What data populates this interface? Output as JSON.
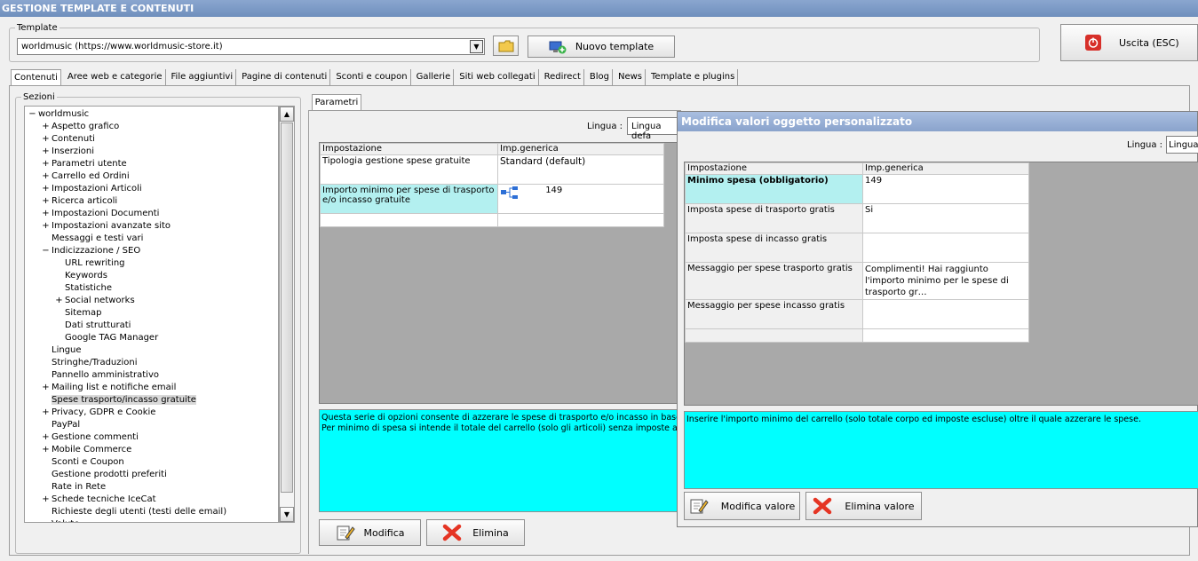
{
  "app": {
    "title": "GESTIONE TEMPLATE E CONTENUTI"
  },
  "template": {
    "group_label": "Template",
    "selected": "worldmusic (https://www.worldmusic-store.it)",
    "new_button": "Nuovo template",
    "exit_button": "Uscita (ESC)"
  },
  "tabs": [
    "Contenuti",
    "Aree web e categorie",
    "File aggiuntivi",
    "Pagine di contenuti",
    "Sconti e coupon",
    "Gallerie",
    "Siti web collegati",
    "Redirect",
    "Blog",
    "News",
    "Template e plugins"
  ],
  "sections": {
    "label": "Sezioni",
    "items": [
      {
        "label": "worldmusic",
        "level": 0,
        "exp": "−"
      },
      {
        "label": "Aspetto grafico",
        "level": 1,
        "exp": "+"
      },
      {
        "label": "Contenuti",
        "level": 1,
        "exp": "+"
      },
      {
        "label": "Inserzioni",
        "level": 1,
        "exp": "+"
      },
      {
        "label": "Parametri utente",
        "level": 1,
        "exp": "+"
      },
      {
        "label": "Carrello ed Ordini",
        "level": 1,
        "exp": "+"
      },
      {
        "label": "Impostazioni Articoli",
        "level": 1,
        "exp": "+"
      },
      {
        "label": "Ricerca articoli",
        "level": 1,
        "exp": "+"
      },
      {
        "label": "Impostazioni Documenti",
        "level": 1,
        "exp": "+"
      },
      {
        "label": "Impostazioni avanzate sito",
        "level": 1,
        "exp": "+"
      },
      {
        "label": "Messaggi e testi vari",
        "level": 1,
        "exp": ""
      },
      {
        "label": "Indicizzazione / SEO",
        "level": 1,
        "exp": "−"
      },
      {
        "label": "URL rewriting",
        "level": 2,
        "exp": ""
      },
      {
        "label": "Keywords",
        "level": 2,
        "exp": ""
      },
      {
        "label": "Statistiche",
        "level": 2,
        "exp": ""
      },
      {
        "label": "Social networks",
        "level": 2,
        "exp": "+"
      },
      {
        "label": "Sitemap",
        "level": 2,
        "exp": ""
      },
      {
        "label": "Dati strutturati",
        "level": 2,
        "exp": ""
      },
      {
        "label": "Google TAG Manager",
        "level": 2,
        "exp": ""
      },
      {
        "label": "Lingue",
        "level": 1,
        "exp": ""
      },
      {
        "label": "Stringhe/Traduzioni",
        "level": 1,
        "exp": ""
      },
      {
        "label": "Pannello amministrativo",
        "level": 1,
        "exp": ""
      },
      {
        "label": "Mailing list e notifiche email",
        "level": 1,
        "exp": "+"
      },
      {
        "label": "Spese trasporto/incasso gratuite",
        "level": 1,
        "exp": "",
        "selected": true
      },
      {
        "label": "Privacy, GDPR e Cookie",
        "level": 1,
        "exp": "+"
      },
      {
        "label": "PayPal",
        "level": 1,
        "exp": ""
      },
      {
        "label": "Gestione commenti",
        "level": 1,
        "exp": "+"
      },
      {
        "label": "Mobile Commerce",
        "level": 1,
        "exp": "+"
      },
      {
        "label": "Sconti e Coupon",
        "level": 1,
        "exp": ""
      },
      {
        "label": "Gestione prodotti preferiti",
        "level": 1,
        "exp": ""
      },
      {
        "label": "Rate in Rete",
        "level": 1,
        "exp": ""
      },
      {
        "label": "Schede tecniche IceCat",
        "level": 1,
        "exp": "+"
      },
      {
        "label": "Richieste degli utenti (testi delle email)",
        "level": 1,
        "exp": ""
      },
      {
        "label": "Valute",
        "level": 1,
        "exp": ""
      }
    ]
  },
  "params": {
    "tab": "Parametri",
    "lingua_label": "Lingua :",
    "lingua_value": "Lingua defa",
    "col_setting": "Impostazione",
    "col_value": "Imp.generica",
    "rows": [
      {
        "setting": "Tipologia gestione spese gratuite",
        "value": "Standard (default)"
      },
      {
        "setting": "Importo minimo per spese di trasporto e/o incasso gratuite",
        "value": "149"
      }
    ],
    "description_line1": "Questa serie di opzioni consente di azzerare le spese di trasporto e/o incasso in base ad un",
    "description_line2": "Per minimo di spesa si intende il totale del carrello (solo gli articoli) senza imposte aggiunte",
    "modify_button": "Modifica",
    "delete_button": "Elimina"
  },
  "dialog": {
    "title": "Modifica valori oggetto personalizzato",
    "lingua_label": "Lingua :",
    "lingua_value": "Lingua",
    "col_setting": "Impostazione",
    "col_value": "Imp.generica",
    "rows": [
      {
        "setting": "Minimo spesa (obbligatorio)",
        "value": "149"
      },
      {
        "setting": "Imposta spese di trasporto gratis",
        "value": "Si"
      },
      {
        "setting": "Imposta spese di incasso gratis",
        "value": ""
      },
      {
        "setting": "Messaggio per spese trasporto gratis",
        "value": "Complimenti! Hai raggiunto l'importo minimo per le spese di trasporto gr…"
      },
      {
        "setting": "Messaggio per spese incasso gratis",
        "value": ""
      }
    ],
    "description": "Inserire l'importo minimo del carrello (solo totale corpo ed imposte escluse) oltre il quale azzerare le spese.",
    "modify_button": "Modifica valore",
    "delete_button": "Elimina valore"
  },
  "colors": {
    "title_bar": "#7090c0",
    "cyan": "#00ffff",
    "dialog_title": "#8aa3cc",
    "grid_bg": "#a9a9a9"
  }
}
